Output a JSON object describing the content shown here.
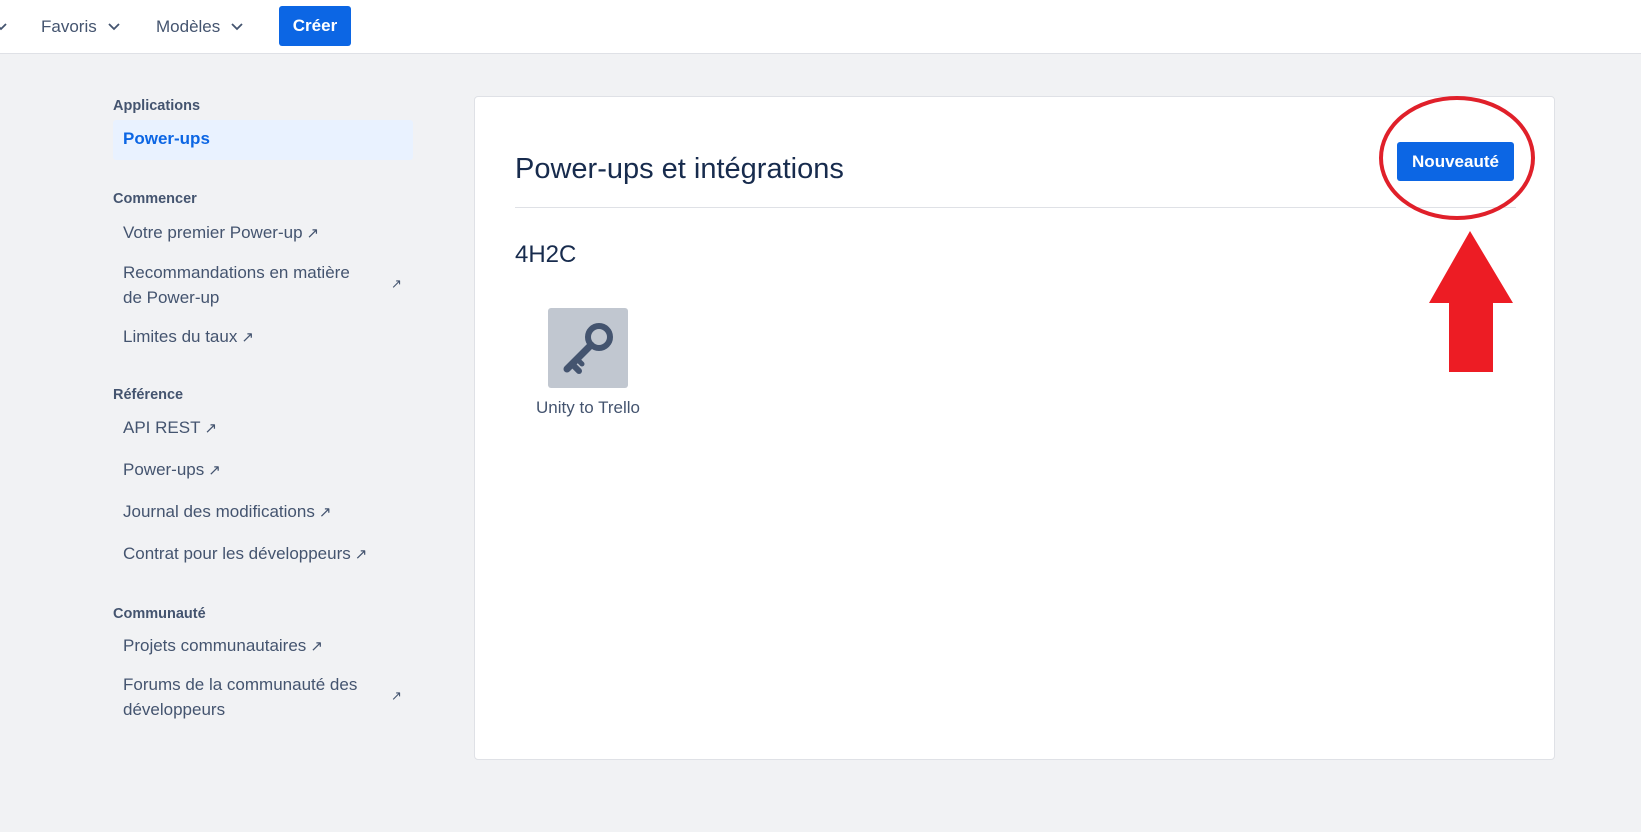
{
  "topbar": {
    "nav": [
      {
        "label": "Favoris"
      },
      {
        "label": "Modèles"
      }
    ],
    "create_label": "Créer"
  },
  "sidebar": {
    "sections": [
      {
        "title": "Applications",
        "items": [
          {
            "label": "Power-ups",
            "active": true
          }
        ]
      },
      {
        "title": "Commencer",
        "items": [
          {
            "label": "Votre premier Power-up",
            "external": true
          },
          {
            "label": "Recommandations en matière de Power-up",
            "external": true
          },
          {
            "label": "Limites du taux",
            "external": true
          }
        ]
      },
      {
        "title": "Référence",
        "items": [
          {
            "label": "API REST",
            "external": true
          },
          {
            "label": "Power-ups",
            "external": true
          },
          {
            "label": "Journal des modifications",
            "external": true
          },
          {
            "label": "Contrat pour les développeurs",
            "external": true
          }
        ]
      },
      {
        "title": "Communauté",
        "items": [
          {
            "label": "Projets communautaires",
            "external": true
          },
          {
            "label": "Forums de la communauté des développeurs",
            "external": true
          }
        ]
      }
    ],
    "external_glyph": "↗"
  },
  "main": {
    "title": "Power-ups et intégrations",
    "new_button_label": "Nouveauté",
    "workspace": {
      "name": "4H2C",
      "powerups": [
        {
          "label": "Unity to Trello",
          "icon": "key-icon"
        }
      ]
    }
  },
  "annotation": {
    "circle_color": "#e0202a",
    "arrow_color": "#ed1c24"
  },
  "colors": {
    "primary": "#0c66e4",
    "background": "#f1f2f4",
    "text": "#172b4d",
    "subtle_text": "#44546f",
    "icon_bg": "#c1c7d0"
  }
}
